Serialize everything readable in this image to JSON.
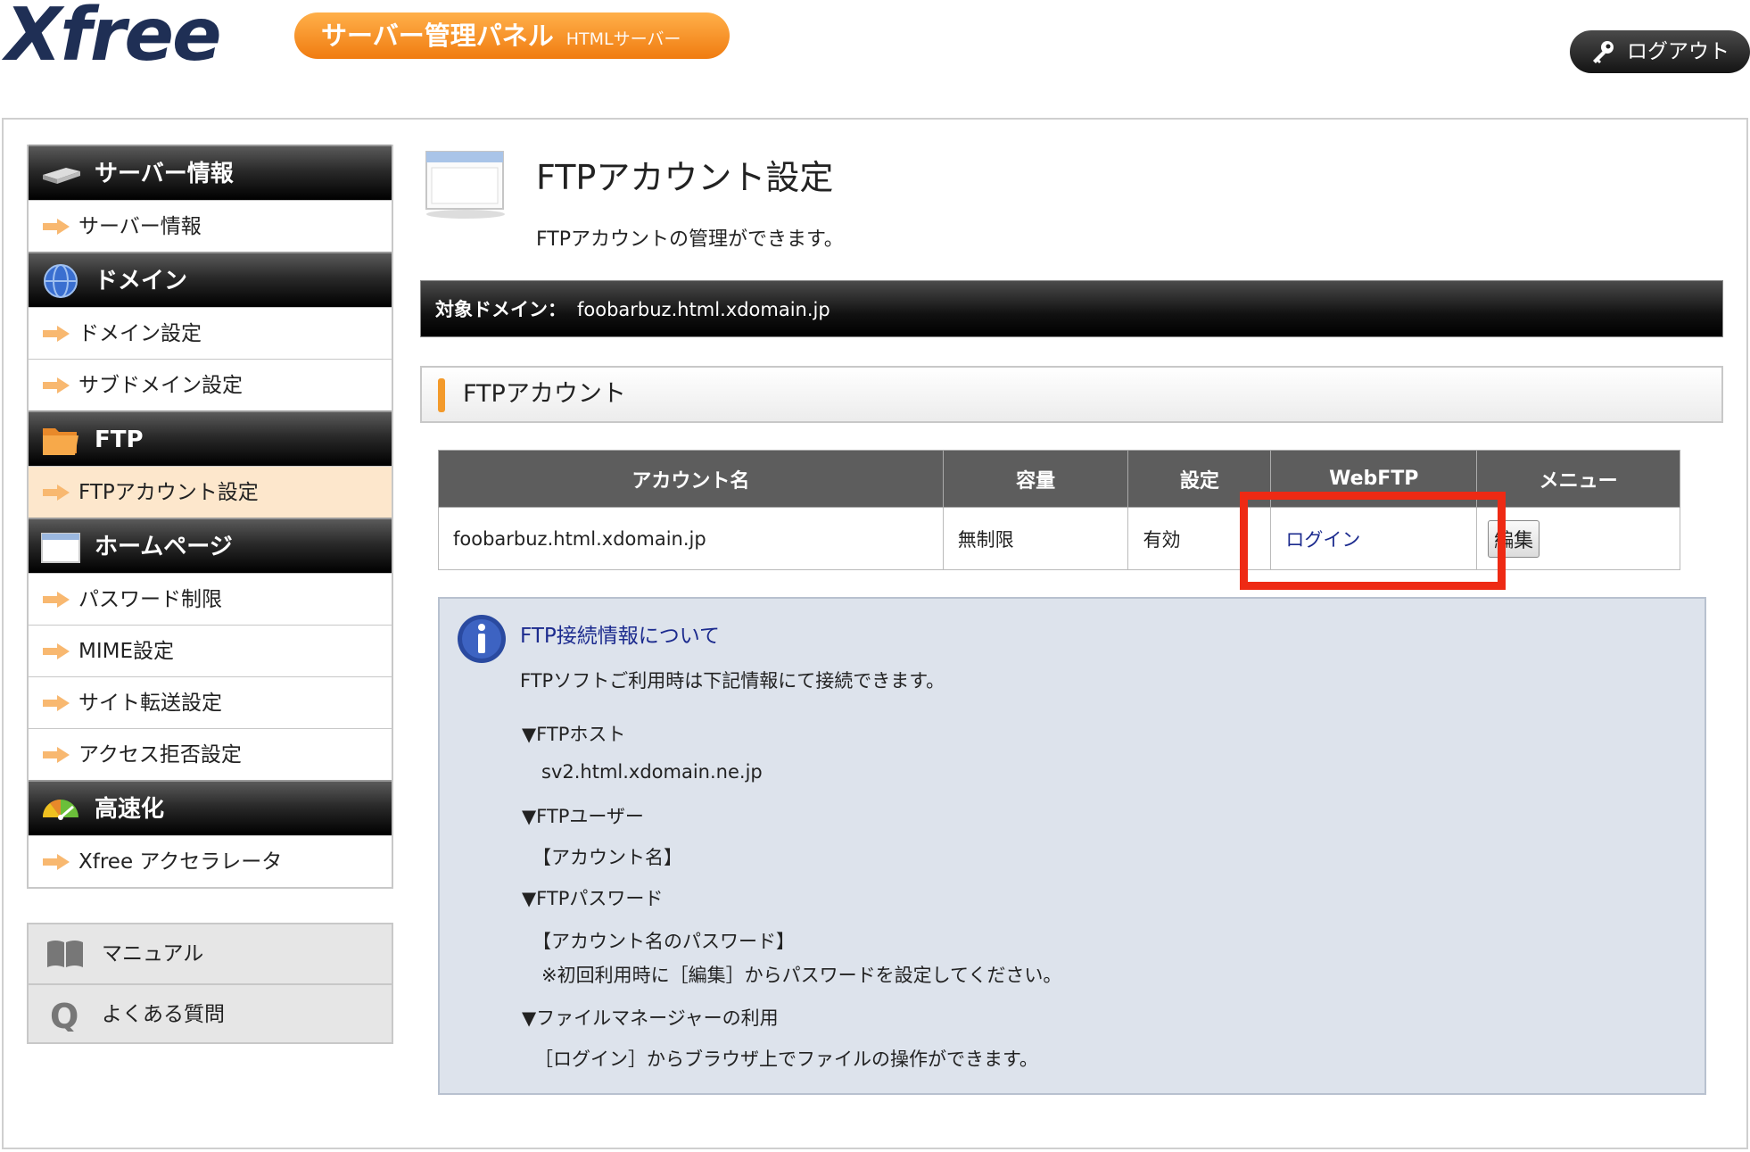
{
  "header": {
    "logo": "Xfree",
    "panel_title": "サーバー管理パネル",
    "panel_sub": "HTMLサーバー",
    "logout": "ログアウト"
  },
  "sidebar": {
    "sections": [
      {
        "title": "サーバー情報",
        "icon": "server-icon",
        "items": [
          "サーバー情報"
        ]
      },
      {
        "title": "ドメイン",
        "icon": "globe-icon",
        "items": [
          "ドメイン設定",
          "サブドメイン設定"
        ]
      },
      {
        "title": "FTP",
        "icon": "folder-icon",
        "items": [
          "FTPアカウント設定"
        ]
      },
      {
        "title": "ホームページ",
        "icon": "window-icon",
        "items": [
          "パスワード制限",
          "MIME設定",
          "サイト転送設定",
          "アクセス拒否設定"
        ]
      },
      {
        "title": "高速化",
        "icon": "speedometer-icon",
        "items": [
          "Xfree アクセラレータ"
        ]
      }
    ],
    "active_item": "FTPアカウント設定",
    "extra": [
      "マニュアル",
      "よくある質問"
    ]
  },
  "main": {
    "title": "FTPアカウント設定",
    "description": "FTPアカウントの管理ができます。",
    "domain_label": "対象ドメイン：",
    "domain_value": "foobarbuz.html.xdomain.jp",
    "section_title": "FTPアカウント",
    "table": {
      "headers": [
        "アカウント名",
        "容量",
        "設定",
        "WebFTP",
        "メニュー"
      ],
      "rows": [
        {
          "account": "foobarbuz.html.xdomain.jp",
          "capacity": "無制限",
          "status": "有効",
          "webftp": "ログイン",
          "menu": "編集"
        }
      ]
    },
    "info": {
      "title": "FTP接続情報について",
      "intro": "FTPソフトご利用時は下記情報にて接続できます。",
      "host_label": "▼FTPホスト",
      "host_value": "sv2.html.xdomain.ne.jp",
      "user_label": "▼FTPユーザー",
      "user_value": "【アカウント名】",
      "pass_label": "▼FTPパスワード",
      "pass_value": "【アカウント名のパスワード】",
      "pass_note": "※初回利用時に［編集］からパスワードを設定してください。",
      "fm_label": "▼ファイルマネージャーの利用",
      "fm_value": "［ログイン］からブラウザ上でファイルの操作ができます。"
    }
  },
  "colors": {
    "accent_orange": "#f07c10",
    "highlight_red": "#ee2a14",
    "link_blue": "#1c2b8e",
    "info_bg": "#dde3ec"
  }
}
